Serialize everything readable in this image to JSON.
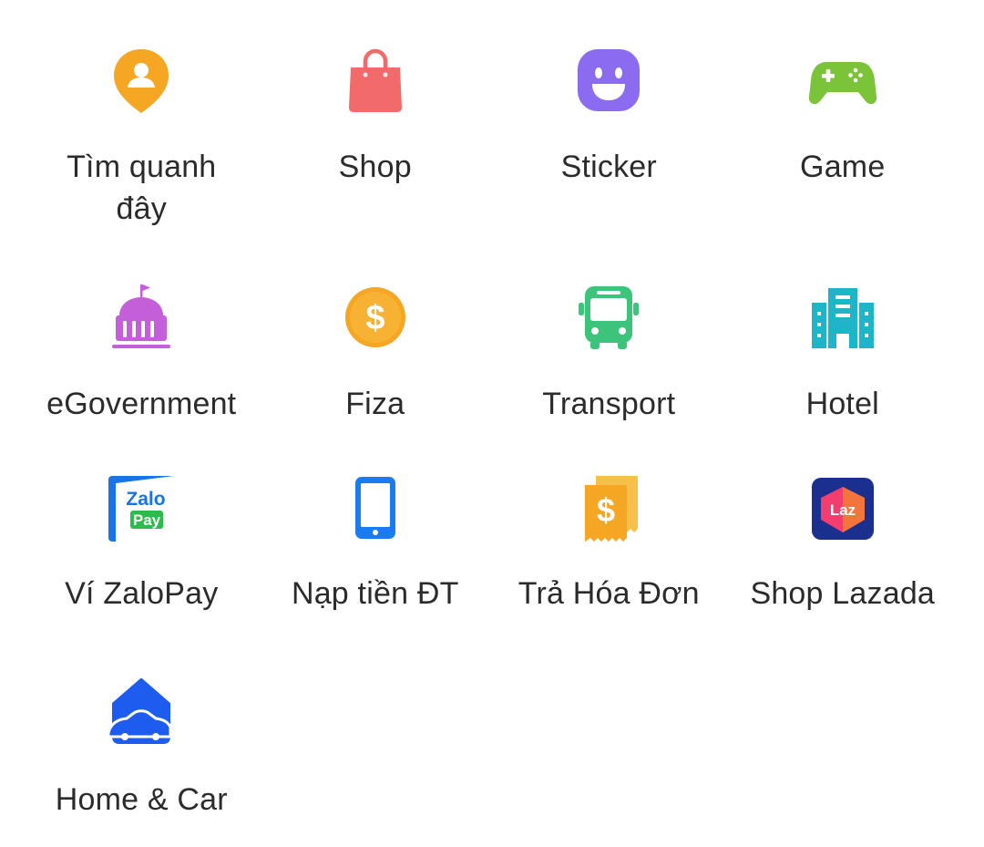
{
  "apps": [
    {
      "label": "Tìm quanh\nđây",
      "icon": "location-person-icon",
      "color": "#F5A623"
    },
    {
      "label": "Shop",
      "icon": "shopping-bag-icon",
      "color": "#F26B6B"
    },
    {
      "label": "Sticker",
      "icon": "smiley-sticker-icon",
      "color": "#8B6CF0"
    },
    {
      "label": "Game",
      "icon": "gamepad-icon",
      "color": "#7BC43A"
    },
    {
      "label": "eGovernment",
      "icon": "government-building-icon",
      "color": "#C35FD8"
    },
    {
      "label": "Fiza",
      "icon": "dollar-coin-icon",
      "color": "#F5A623"
    },
    {
      "label": "Transport",
      "icon": "bus-icon",
      "color": "#3CC47A"
    },
    {
      "label": "Hotel",
      "icon": "hotel-building-icon",
      "color": "#1FB5C9"
    },
    {
      "label": "Ví ZaloPay",
      "icon": "zalopay-logo-icon",
      "color": "#1B74E4",
      "logo_text": [
        "Zalo",
        "Pay"
      ]
    },
    {
      "label": "Nạp tiền ĐT",
      "icon": "mobile-phone-icon",
      "color": "#1A7CF0"
    },
    {
      "label": "Trả Hóa Đơn",
      "icon": "bill-receipt-icon",
      "color": "#F5A623"
    },
    {
      "label": "Shop Lazada",
      "icon": "lazada-logo-icon",
      "color": "#1B2F8F",
      "logo_text": [
        "Laz"
      ]
    },
    {
      "label": "Home & Car",
      "icon": "home-car-icon",
      "color": "#1E5CF0"
    }
  ]
}
